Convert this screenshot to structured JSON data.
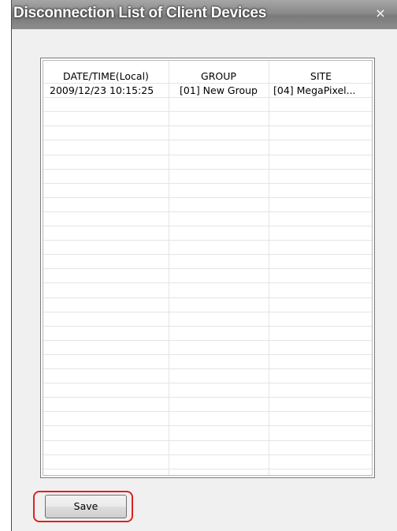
{
  "window": {
    "title": "Disconnection List of Client Devices",
    "close_glyph": "×"
  },
  "table": {
    "columns": [
      "DATE/TIME(Local)",
      "GROUP",
      "SITE"
    ],
    "rows": [
      [
        "2009/12/23 10:15:25",
        "[01] New Group",
        "[04] MegaPixel..."
      ]
    ]
  },
  "footer": {
    "save_label": "Save"
  },
  "colors": {
    "highlight": "#e02020",
    "titlebar": "#8a8a8a"
  }
}
